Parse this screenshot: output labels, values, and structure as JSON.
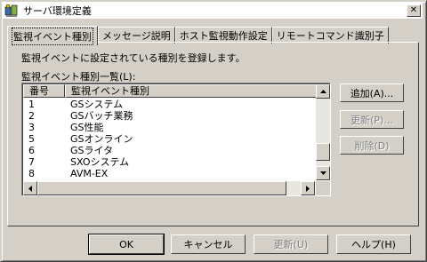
{
  "window": {
    "title": "サーバ環境定義",
    "close_glyph": "✕"
  },
  "tabs": [
    {
      "label": "監視イベント種別"
    },
    {
      "label": "メッセージ説明"
    },
    {
      "label": "ホスト監視動作設定"
    },
    {
      "label": "リモートコマンド識別子"
    }
  ],
  "main": {
    "description": "監視イベントに設定されている種別を登録します。",
    "list_label": "監視イベント種別一覧(L):",
    "columns": [
      "番号",
      "監視イベント種別"
    ],
    "rows": [
      {
        "no": "1",
        "type": "GSシステム"
      },
      {
        "no": "2",
        "type": "GSバッチ業務"
      },
      {
        "no": "3",
        "type": "GS性能"
      },
      {
        "no": "5",
        "type": "GSオンライン"
      },
      {
        "no": "6",
        "type": "GSライタ"
      },
      {
        "no": "7",
        "type": "SXOシステム"
      },
      {
        "no": "8",
        "type": "AVM-EX"
      }
    ]
  },
  "side_buttons": {
    "add": "追加(A)...",
    "update": "更新(P)...",
    "delete": "削除(D)"
  },
  "bottom_buttons": {
    "ok": "OK",
    "cancel": "キャンセル",
    "apply": "更新(U)",
    "help": "ヘルプ(H)"
  },
  "icons": {
    "app": "app-icon",
    "close": "close-icon",
    "scroll_up": "arrow-up-icon",
    "scroll_down": "arrow-down-icon",
    "scroll_left": "arrow-left-icon",
    "scroll_right": "arrow-right-icon"
  }
}
